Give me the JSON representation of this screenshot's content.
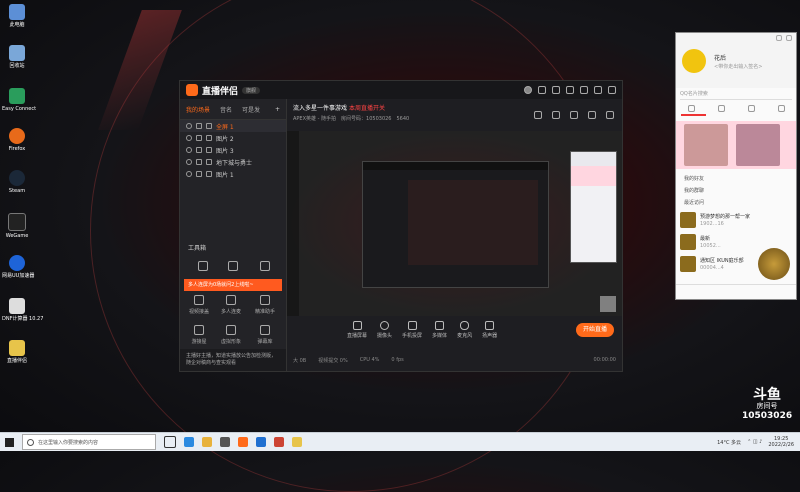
{
  "desktop": {
    "icons": [
      {
        "label": "此电脑",
        "color": "#5c8fd6"
      },
      {
        "label": "回收站",
        "color": "#7aa7d8"
      },
      {
        "label": "Easy Connect",
        "color": "#2a9d5c"
      },
      {
        "label": "Firefox",
        "color": "#e86a1a"
      },
      {
        "label": "Steam",
        "color": "#1b2838"
      },
      {
        "label": "WeGame",
        "color": "#222"
      },
      {
        "label": "网易UU加速器",
        "color": "#1e64d8"
      },
      {
        "label": "DNF计算器 10.27",
        "color": "#ddd"
      },
      {
        "label": "直播伴侣",
        "color": "#e7c44a"
      }
    ]
  },
  "app": {
    "logo": "直播伴侣",
    "version": "旗舰",
    "tabs": [
      "我的场景",
      "音名",
      "可是发"
    ],
    "scenes": [
      "全屏 1",
      "图片 2",
      "图片 3",
      "地下城与勇士",
      "图片 1"
    ],
    "toolbox_title": "工具箱",
    "tools": [
      "",
      "",
      "",
      "视频接盖",
      "多人连麦",
      "精准助手",
      "游接屋",
      "虚拟形象",
      "弹幕库"
    ],
    "banner": "多人连屏为0场就问2上线啦~",
    "notice": "主播好主播，知道实播放公告加检测版，随企对稿商与查实观看",
    "stream_title": "流入多星一件事游戏",
    "stream_title_red": "本周直播开关",
    "sub_info": "APEX英雄 - 随手拍",
    "room_label": "房间号码：10503026",
    "hot": "5640",
    "controls": [
      "直播屏幕",
      "摄像头",
      "手机投屏",
      "多媒体",
      "麦克风",
      "扬声器"
    ],
    "start_label": "开始直播",
    "status": [
      "大 0B",
      "视频提交 0%",
      "CPU 4%",
      "0 fps",
      "00:00:00"
    ]
  },
  "chat": {
    "name": "花后",
    "sub": "<带你走出输入签名>",
    "search_placeholder": "QQ名片搜索",
    "items": [
      "我的好友",
      "我的群聊",
      "最近访问"
    ],
    "contacts": [
      {
        "name": "预游梦想的那一帮一家",
        "sub": "1902...16"
      },
      {
        "name": "最新",
        "sub": "10052..."
      },
      {
        "name": "通知区 IKUN庭乐部",
        "sub": "00004...4"
      }
    ]
  },
  "room": {
    "big": "斗鱼",
    "label": "房间号",
    "number": "10503026"
  },
  "taskbar": {
    "search_placeholder": "在这里输入你要搜索的内容",
    "weather": "14°C 多云",
    "time": "19:25",
    "date": "2022/2/26"
  }
}
